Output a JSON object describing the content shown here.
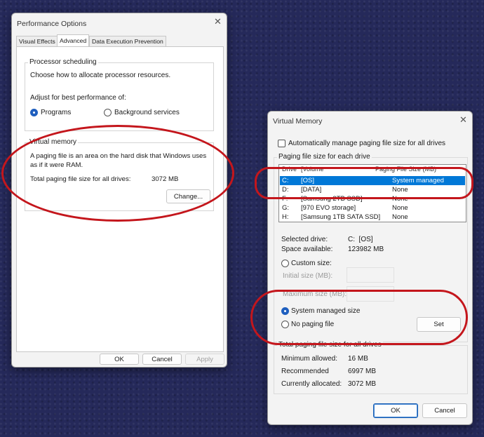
{
  "performance_options": {
    "title": "Performance Options",
    "tabs": [
      {
        "label": "Visual Effects",
        "active": false
      },
      {
        "label": "Advanced",
        "active": true
      },
      {
        "label": "Data Execution Prevention",
        "active": false
      }
    ],
    "processor_scheduling": {
      "legend": "Processor scheduling",
      "description": "Choose how to allocate processor resources.",
      "adjust_label": "Adjust for best performance of:",
      "options": [
        {
          "label": "Programs",
          "checked": true
        },
        {
          "label": "Background services",
          "checked": false
        }
      ]
    },
    "virtual_memory": {
      "legend": "Virtual memory",
      "description_line1": "A paging file is an area on the hard disk that Windows uses",
      "description_line2": "as if it were RAM.",
      "total_label": "Total paging file size for all drives:",
      "total_value": "3072 MB",
      "change_button": "Change..."
    },
    "buttons": {
      "ok": "OK",
      "cancel": "Cancel",
      "apply": "Apply"
    }
  },
  "virtual_memory_dialog": {
    "title": "Virtual Memory",
    "auto_manage_label": "Automatically manage paging file size for all drives",
    "auto_manage_checked": false,
    "section_label": "Paging file size for each drive",
    "columns": {
      "drive": "Drive",
      "volume": "[Volume",
      "paging": "Paging File Size (MB)"
    },
    "drives": [
      {
        "drive": "C:",
        "volume": "[OS]",
        "size": "System managed",
        "selected": true
      },
      {
        "drive": "D:",
        "volume": "[DATA]",
        "size": "None",
        "selected": false
      },
      {
        "drive": "F:",
        "volume": "[Samsung 2TB SSD]",
        "size": "None",
        "selected": false
      },
      {
        "drive": "G:",
        "volume": "[970 EVO storage]",
        "size": "None",
        "selected": false
      },
      {
        "drive": "H:",
        "volume": "[Samsung 1TB SATA SSD]",
        "size": "None",
        "selected": false
      }
    ],
    "selected_drive_label": "Selected drive:",
    "selected_drive_value": "C:  [OS]",
    "space_available_label": "Space available:",
    "space_available_value": "123982 MB",
    "custom_size_label": "Custom size:",
    "initial_size_label": "Initial size (MB):",
    "maximum_size_label": "Maximum size (MB):",
    "system_managed_label": "System managed size",
    "no_paging_label": "No paging file",
    "selected_option": "system_managed",
    "set_button": "Set",
    "totals_label": "Total paging file size for all drives",
    "minimum_label": "Minimum allowed:",
    "minimum_value": "16 MB",
    "recommended_label": "Recommended",
    "recommended_value": "6997 MB",
    "allocated_label": "Currently allocated:",
    "allocated_value": "3072 MB",
    "buttons": {
      "ok": "OK",
      "cancel": "Cancel"
    }
  },
  "colors": {
    "annotation": "#c4161c",
    "selection": "#0078d7",
    "accent": "#1f5fbf"
  }
}
